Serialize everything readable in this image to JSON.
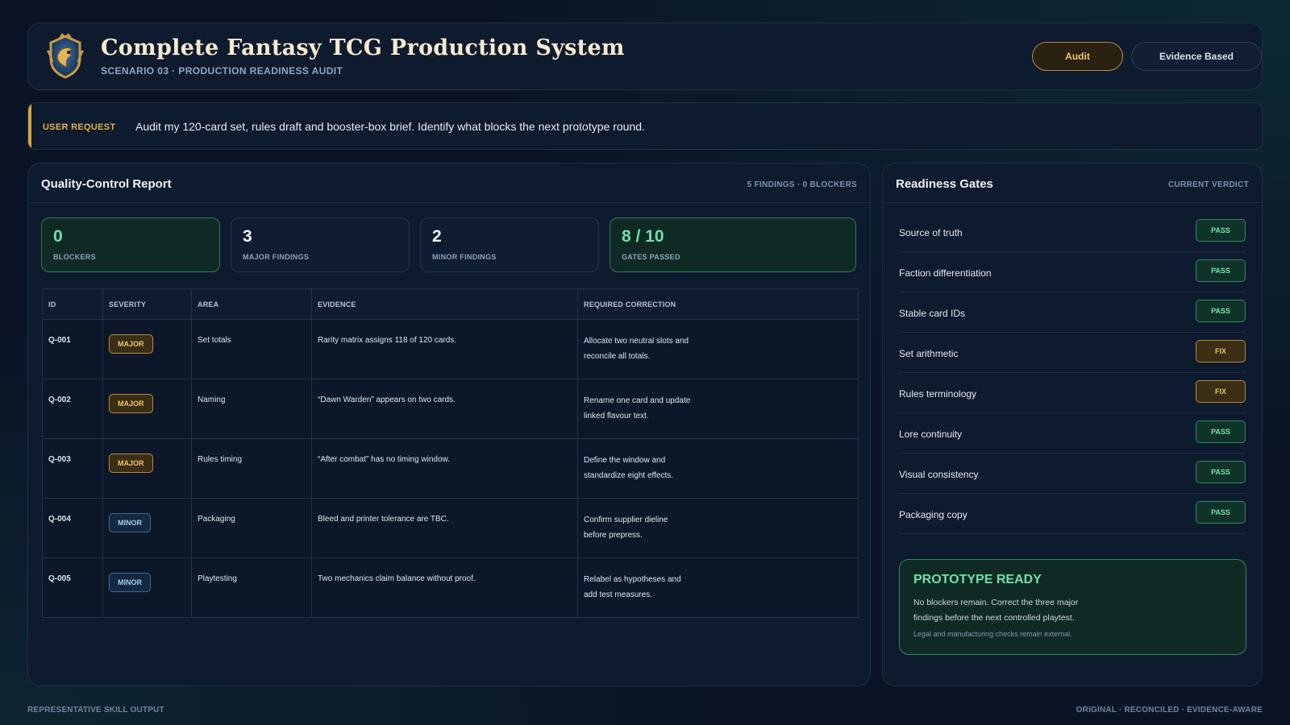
{
  "header": {
    "title": "Complete Fantasy TCG Production System",
    "subtitle": "SCENARIO 03 · PRODUCTION READINESS AUDIT",
    "logo_icon": "dragon-crest-icon",
    "buttons": {
      "audit": "Audit",
      "evidence": "Evidence Based"
    }
  },
  "request": {
    "label": "USER REQUEST",
    "text": "Audit my 120-card set, rules draft and booster-box brief. Identify what blocks the next prototype round."
  },
  "qc": {
    "title": "Quality-Control Report",
    "meta": "5 FINDINGS · 0 BLOCKERS",
    "stats": [
      {
        "value": "0",
        "label": "BLOCKERS"
      },
      {
        "value": "3",
        "label": "MAJOR FINDINGS"
      },
      {
        "value": "2",
        "label": "MINOR FINDINGS"
      },
      {
        "value": "8 / 10",
        "label": "GATES PASSED"
      }
    ],
    "columns": [
      "ID",
      "SEVERITY",
      "AREA",
      "EVIDENCE",
      "REQUIRED CORRECTION"
    ],
    "rows": [
      {
        "id": "Q-001",
        "severity": "MAJOR",
        "area": "Set totals",
        "evidence": "Rarity matrix assigns 118 of 120 cards.",
        "correction_1": "Allocate two neutral slots and",
        "correction_2": "reconcile all totals."
      },
      {
        "id": "Q-002",
        "severity": "MAJOR",
        "area": "Naming",
        "evidence": "“Dawn Warden” appears on two cards.",
        "correction_1": "Rename one card and update",
        "correction_2": "linked flavour text."
      },
      {
        "id": "Q-003",
        "severity": "MAJOR",
        "area": "Rules timing",
        "evidence": "“After combat” has no timing window.",
        "correction_1": "Define the window and",
        "correction_2": "standardize eight effects."
      },
      {
        "id": "Q-004",
        "severity": "MINOR",
        "area": "Packaging",
        "evidence": "Bleed and printer tolerance are TBC.",
        "correction_1": "Confirm supplier dieline",
        "correction_2": "before prepress."
      },
      {
        "id": "Q-005",
        "severity": "MINOR",
        "area": "Playtesting",
        "evidence": "Two mechanics claim balance without proof.",
        "correction_1": "Relabel as hypotheses and",
        "correction_2": "add test measures."
      }
    ]
  },
  "gates": {
    "title": "Readiness Gates",
    "meta": "CURRENT VERDICT",
    "items": [
      {
        "label": "Source of truth",
        "status": "PASS"
      },
      {
        "label": "Faction differentiation",
        "status": "PASS"
      },
      {
        "label": "Stable card IDs",
        "status": "PASS"
      },
      {
        "label": "Set arithmetic",
        "status": "FIX"
      },
      {
        "label": "Rules terminology",
        "status": "FIX"
      },
      {
        "label": "Lore continuity",
        "status": "PASS"
      },
      {
        "label": "Visual consistency",
        "status": "PASS"
      },
      {
        "label": "Packaging copy",
        "status": "PASS"
      }
    ],
    "verdict": {
      "title": "PROTOTYPE READY",
      "body_1": "No blockers remain. Correct the three major",
      "body_2": "findings before the next controlled playtest.",
      "note": "Legal and manufacturing checks remain external."
    }
  },
  "footer": {
    "left": "REPRESENTATIVE SKILL OUTPUT",
    "right": "ORIGINAL · RECONCILED · EVIDENCE-AWARE"
  },
  "colors": {
    "background": "#0a1424",
    "accent_gold": "#d9a43c",
    "pass_green": "#74e3ad",
    "fix_amber": "#f1c46a",
    "minor_blue": "#9fd0f4"
  }
}
